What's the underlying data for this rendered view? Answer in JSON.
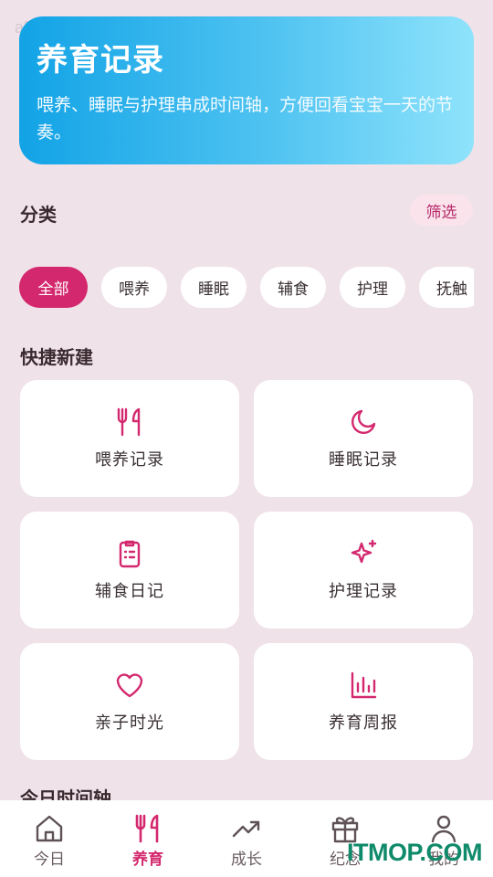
{
  "watermark": "a57eeb",
  "hero": {
    "title": "养育记录",
    "description": "喂养、睡眠与护理串成时间轴，方便回看宝宝一天的节奏。"
  },
  "category": {
    "title": "分类",
    "filter_label": "筛选",
    "chips": [
      "全部",
      "喂养",
      "睡眠",
      "辅食",
      "护理",
      "抚触"
    ],
    "active_index": 0
  },
  "quick_create": {
    "title": "快捷新建",
    "cards": [
      {
        "label": "喂养记录",
        "icon": "utensils-icon"
      },
      {
        "label": "睡眠记录",
        "icon": "moon-icon"
      },
      {
        "label": "辅食日记",
        "icon": "clipboard-icon"
      },
      {
        "label": "护理记录",
        "icon": "sparkle-icon"
      },
      {
        "label": "亲子时光",
        "icon": "heart-icon"
      },
      {
        "label": "养育周报",
        "icon": "bar-chart-icon"
      }
    ]
  },
  "timeline": {
    "title": "今日时间轴"
  },
  "bottom_nav": {
    "items": [
      {
        "label": "今日",
        "icon": "home-icon"
      },
      {
        "label": "养育",
        "icon": "utensils-icon"
      },
      {
        "label": "成长",
        "icon": "trend-icon"
      },
      {
        "label": "纪念",
        "icon": "gift-icon"
      },
      {
        "label": "我的",
        "icon": "user-icon"
      }
    ],
    "active_index": 1
  },
  "brand_watermark": "ITMOP.COM",
  "colors": {
    "accent": "#d4286e",
    "background": "#efe2e8",
    "hero_gradient_start": "#12a3e6",
    "hero_gradient_end": "#8fe3fb"
  }
}
